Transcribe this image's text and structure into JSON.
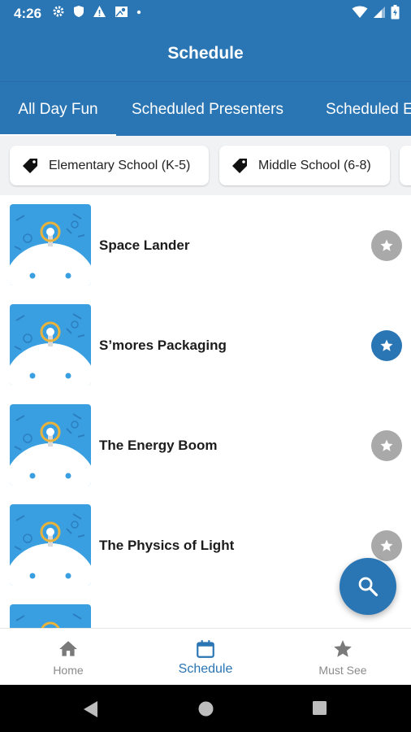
{
  "status_bar": {
    "time": "4:26"
  },
  "app_bar": {
    "title": "Schedule"
  },
  "tabs": [
    {
      "label": "All Day Fun",
      "active": true
    },
    {
      "label": "Scheduled Presenters",
      "active": false
    },
    {
      "label": "Scheduled E",
      "active": false
    }
  ],
  "filters": [
    {
      "label": "Elementary School (K-5)",
      "icon": "tag-icon"
    },
    {
      "label": "Middle School (6-8)",
      "icon": "tag-icon"
    }
  ],
  "items": [
    {
      "title": "Space Lander",
      "favorited": false
    },
    {
      "title": "S’mores Packaging",
      "favorited": true
    },
    {
      "title": "The Energy Boom",
      "favorited": false
    },
    {
      "title": "The Physics of Light",
      "favorited": false
    },
    {
      "title": "",
      "favorited": false
    }
  ],
  "bottom_nav": [
    {
      "label": "Home",
      "icon": "home-icon",
      "active": false
    },
    {
      "label": "Schedule",
      "icon": "calendar-icon",
      "active": true
    },
    {
      "label": "Must See",
      "icon": "star-icon",
      "active": false
    }
  ],
  "colors": {
    "primary": "#2a75b3",
    "thumb_blue": "#3a9fe0",
    "gold": "#e8b33c",
    "fav_off": "#a9a9a9"
  }
}
